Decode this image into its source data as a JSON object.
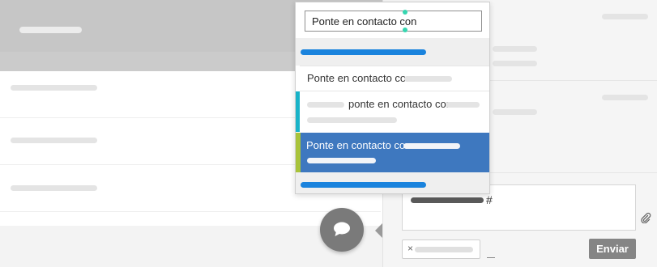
{
  "search": {
    "value": "Ponte en contacto con"
  },
  "suggestions": [
    {
      "label": "Ponte en contacto con"
    },
    {
      "label": "ponte en contacto con"
    },
    {
      "label": "Ponte en contacto con"
    }
  ],
  "composer": {
    "suffix": "#"
  },
  "tag": {
    "remove_label": "×"
  },
  "send_button": {
    "label": "Enviar"
  },
  "icons": {
    "chat": "chat-bubble-icon",
    "attach": "paperclip-icon",
    "remove": "close-icon"
  },
  "colors": {
    "selected_item": "#3e78bf",
    "accent_cyan": "#18b3c8",
    "accent_green": "#a8c33a",
    "blue_bar": "#1a83dd",
    "send_button": "#858585",
    "fab": "#7a7a7a"
  }
}
